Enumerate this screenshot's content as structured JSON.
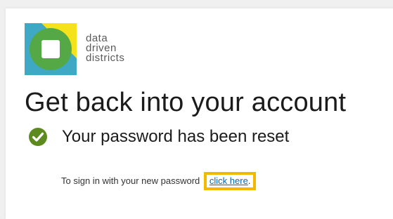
{
  "logo": {
    "line1": "data",
    "line2": "driven",
    "line3": "districts",
    "colors": {
      "green": "#54a846",
      "yellow": "#f4e21b",
      "blue": "#3fa9c5",
      "white": "#ffffff"
    }
  },
  "heading": "Get back into your account",
  "status": {
    "icon": "check-circle-icon",
    "icon_color": "#5d8a1e",
    "text": "Your password has been reset"
  },
  "signin": {
    "prefix": "To sign in with your new password",
    "link": "click here",
    "suffix": ".",
    "highlight_color": "#f5b800"
  }
}
